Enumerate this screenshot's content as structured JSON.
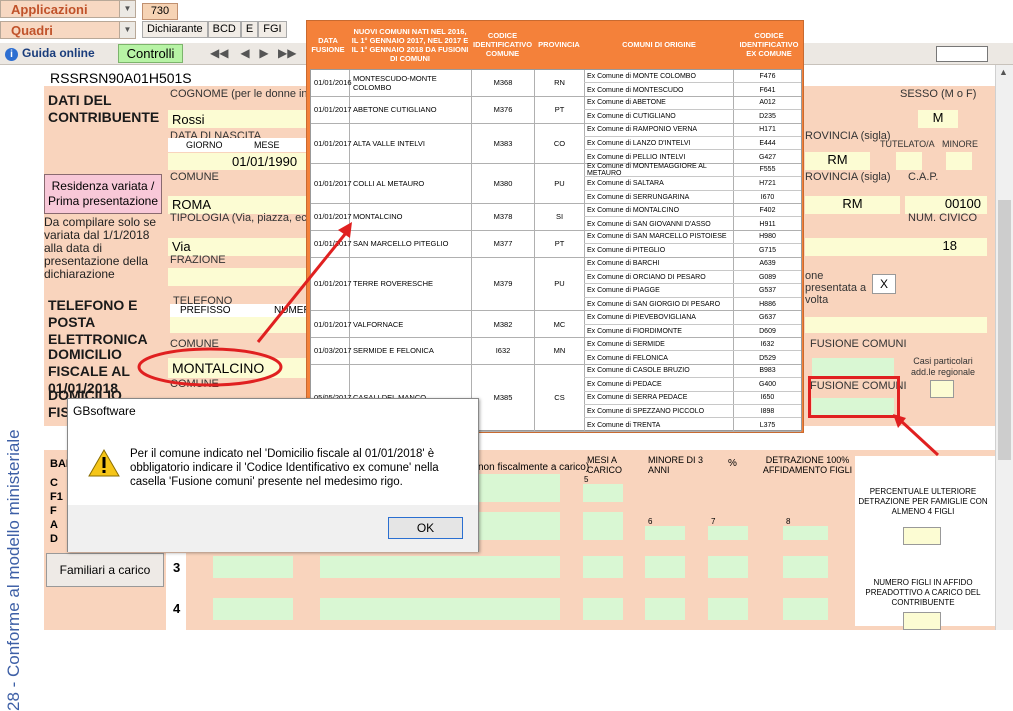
{
  "top": {
    "menu1": "Applicazioni",
    "menu2": "Quadri",
    "tab730": "730",
    "tabs": [
      "Dichiarante",
      "BCD",
      "E",
      "FGI"
    ],
    "guida": "Guida online",
    "controlli": "Controlli"
  },
  "sidebar": {
    "vertical_text": "28 - Conforme al modello ministeriale"
  },
  "form": {
    "codice_fiscale": "RSSRSN90A01H501S",
    "dati_contribuente": "DATI DEL CONTRIBUENTE",
    "cognome_label": "COGNOME (per le donne indi",
    "cognome": "Rossi",
    "data_nascita_label": "DATA DI NASCITA",
    "giorno_label": "GIORNO",
    "mese_label": "MESE",
    "data_nascita": "01/01/1990",
    "sesso_label": "SESSO (M o F)",
    "sesso": "M",
    "provincia_label": "ROVINCIA (sigla)",
    "provincia": "RM",
    "tutelato_label": "TUTELATO/A",
    "minore_label": "MINORE",
    "residenza_btn": "Residenza variata / Prima presentazione",
    "da_compilare": "Da compilare solo se variata dal 1/1/2018 alla data di presentazione della dichiarazione",
    "comune_label": "COMUNE",
    "comune": "ROMA",
    "provincia2_label": "ROVINCIA (sigla)",
    "provincia2": "RM",
    "cap_label": "C.A.P.",
    "cap": "00100",
    "tipologia_label": "TIPOLOGIA (Via, piazza, ecc.)",
    "tipologia": "Via",
    "num_civico_label": "NUM. CIVICO",
    "num_civico": "18",
    "frazione_label": "FRAZIONE",
    "presentata_text": "one presentata a volta",
    "presentata_value": "X",
    "telefono_section": "TELEFONO E POSTA ELETTRONICA",
    "telefono_label": "TELEFONO",
    "prefisso_label": "PREFISSO",
    "numero_label": "NUMER",
    "domicilio1_label": "DOMICILIO FISCALE AL 01/01/2018",
    "domicilio1_comune_label": "COMUNE",
    "domicilio1_comune": "MONTALCINO",
    "fusione1_label": "FUSIONE COMUNI",
    "casi_particolari": "Casi particolari add.le regionale",
    "domicilio2_label": "DOMICILIO FISCALE AL",
    "domicilio2_comune_label": "COMUNE",
    "fusione2_label": "FUSIONE COMUNI",
    "familiari_codes": [
      "C",
      "F1",
      "F",
      "A",
      "D"
    ],
    "familiari_head": "BAR",
    "mesi_carico": "MESI A CARICO",
    "minore_3anni": "MINORE DI 3 ANNI",
    "perc": "%",
    "detrazione": "DETRAZIONE 100% AFFIDAMENTO FIGLI",
    "fiscal_text": "non fiscalmente a carico)",
    "familiari_btn": "Familiari a carico",
    "row3": "3",
    "row4": "4",
    "field5": "5",
    "field6": "6",
    "field7": "7",
    "field8": "8",
    "percentuale_label": "PERCENTUALE ULTERIORE DETRAZIONE PER FAMIGLIE CON ALMENO 4 FIGLI",
    "numero_figli_label": "NUMERO FIGLI IN AFFIDO PREADOTTIVO A CARICO DEL CONTRIBUENTE"
  },
  "overlay": {
    "headers": [
      "DATA FUSIONE",
      "NUOVI COMUNI NATI NEL 2016, IL 1° GENNAIO 2017, NEL 2017 E IL 1° GENNAIO 2018 DA FUSIONI DI COMUNI",
      "CODICE IDENTIFICATIVO COMUNE",
      "PROVINCIA",
      "COMUNI DI ORIGINE",
      "CODICE IDENTIFICATIVO EX COMUNE"
    ],
    "rows": [
      {
        "data": "01/01/2016",
        "nome": "MONTESCUDO-MONTE COLOMBO",
        "codice": "M368",
        "prov": "RN",
        "origini": [
          [
            "Ex Comune di MONTE COLOMBO",
            "F476"
          ],
          [
            "Ex Comune di MONTESCUDO",
            "F641"
          ]
        ]
      },
      {
        "data": "01/01/2017",
        "nome": "ABETONE CUTIGLIANO",
        "codice": "M376",
        "prov": "PT",
        "origini": [
          [
            "Ex Comune di ABETONE",
            "A012"
          ],
          [
            "Ex Comune di CUTIGLIANO",
            "D235"
          ]
        ]
      },
      {
        "data": "01/01/2017",
        "nome": "ALTA VALLE INTELVI",
        "codice": "M383",
        "prov": "CO",
        "origini": [
          [
            "Ex Comune di RAMPONIO VERNA",
            "H171"
          ],
          [
            "Ex Comune di LANZO D'INTELVI",
            "E444"
          ],
          [
            "Ex Comune di PELLIO INTELVI",
            "G427"
          ]
        ]
      },
      {
        "data": "01/01/2017",
        "nome": "COLLI AL METAURO",
        "codice": "M380",
        "prov": "PU",
        "origini": [
          [
            "Ex Comune di MONTEMAGGIORE AL METAURO",
            "F555"
          ],
          [
            "Ex Comune di SALTARA",
            "H721"
          ],
          [
            "Ex Comune di SERRUNGARINA",
            "I670"
          ]
        ]
      },
      {
        "data": "01/01/2017",
        "nome": "MONTALCINO",
        "codice": "M378",
        "prov": "SI",
        "origini": [
          [
            "Ex Comune di MONTALCINO",
            "F402"
          ],
          [
            "Ex Comune di SAN GIOVANNI D'ASSO",
            "H911"
          ]
        ]
      },
      {
        "data": "01/01/2017",
        "nome": "SAN MARCELLO PITEGLIO",
        "codice": "M377",
        "prov": "PT",
        "origini": [
          [
            "Ex Comune di SAN MARCELLO PISTOIESE",
            "H980"
          ],
          [
            "Ex Comune di PITEGLIO",
            "G715"
          ]
        ]
      },
      {
        "data": "01/01/2017",
        "nome": "TERRE ROVERESCHE",
        "codice": "M379",
        "prov": "PU",
        "origini": [
          [
            "Ex Comune di BARCHI",
            "A639"
          ],
          [
            "Ex Comune di ORCIANO DI PESARO",
            "G089"
          ],
          [
            "Ex Comune di PIAGGE",
            "G537"
          ],
          [
            "Ex Comune di SAN GIORGIO DI PESARO",
            "H886"
          ]
        ]
      },
      {
        "data": "01/01/2017",
        "nome": "VALFORNACE",
        "codice": "M382",
        "prov": "MC",
        "origini": [
          [
            "Ex Comune di PIEVEBOVIGLIANA",
            "G637"
          ],
          [
            "Ex Comune di FIORDIMONTE",
            "D609"
          ]
        ]
      },
      {
        "data": "01/03/2017",
        "nome": "SERMIDE E FELONICA",
        "codice": "I632",
        "prov": "MN",
        "origini": [
          [
            "Ex Comune di SERMIDE",
            "I632"
          ],
          [
            "Ex Comune di FELONICA",
            "D529"
          ]
        ]
      },
      {
        "data": "05/05/2017",
        "nome": "CASALI DEL MANCO",
        "codice": "M385",
        "prov": "CS",
        "origini": [
          [
            "Ex Comune di CASOLE BRUZIO",
            "B983"
          ],
          [
            "Ex Comune di PEDACE",
            "G400"
          ],
          [
            "Ex Comune di SERRA PEDACE",
            "I650"
          ],
          [
            "Ex Comune di SPEZZANO PICCOLO",
            "I898"
          ],
          [
            "Ex Comune di TRENTA",
            "L375"
          ]
        ]
      }
    ]
  },
  "dialog": {
    "title": "GBsoftware",
    "message": "Per il comune indicato nel 'Domicilio fiscale al 01/01/2018' è obbligatorio indicare il 'Codice Identificativo ex comune' nella casella 'Fusione comuni' presente nel medesimo rigo.",
    "ok": "OK"
  },
  "colors": {
    "accent_orange": "#f4813a",
    "annotation_red": "#e02020",
    "field_yellow": "#fcfcd3",
    "field_green": "#d9f7d3"
  }
}
